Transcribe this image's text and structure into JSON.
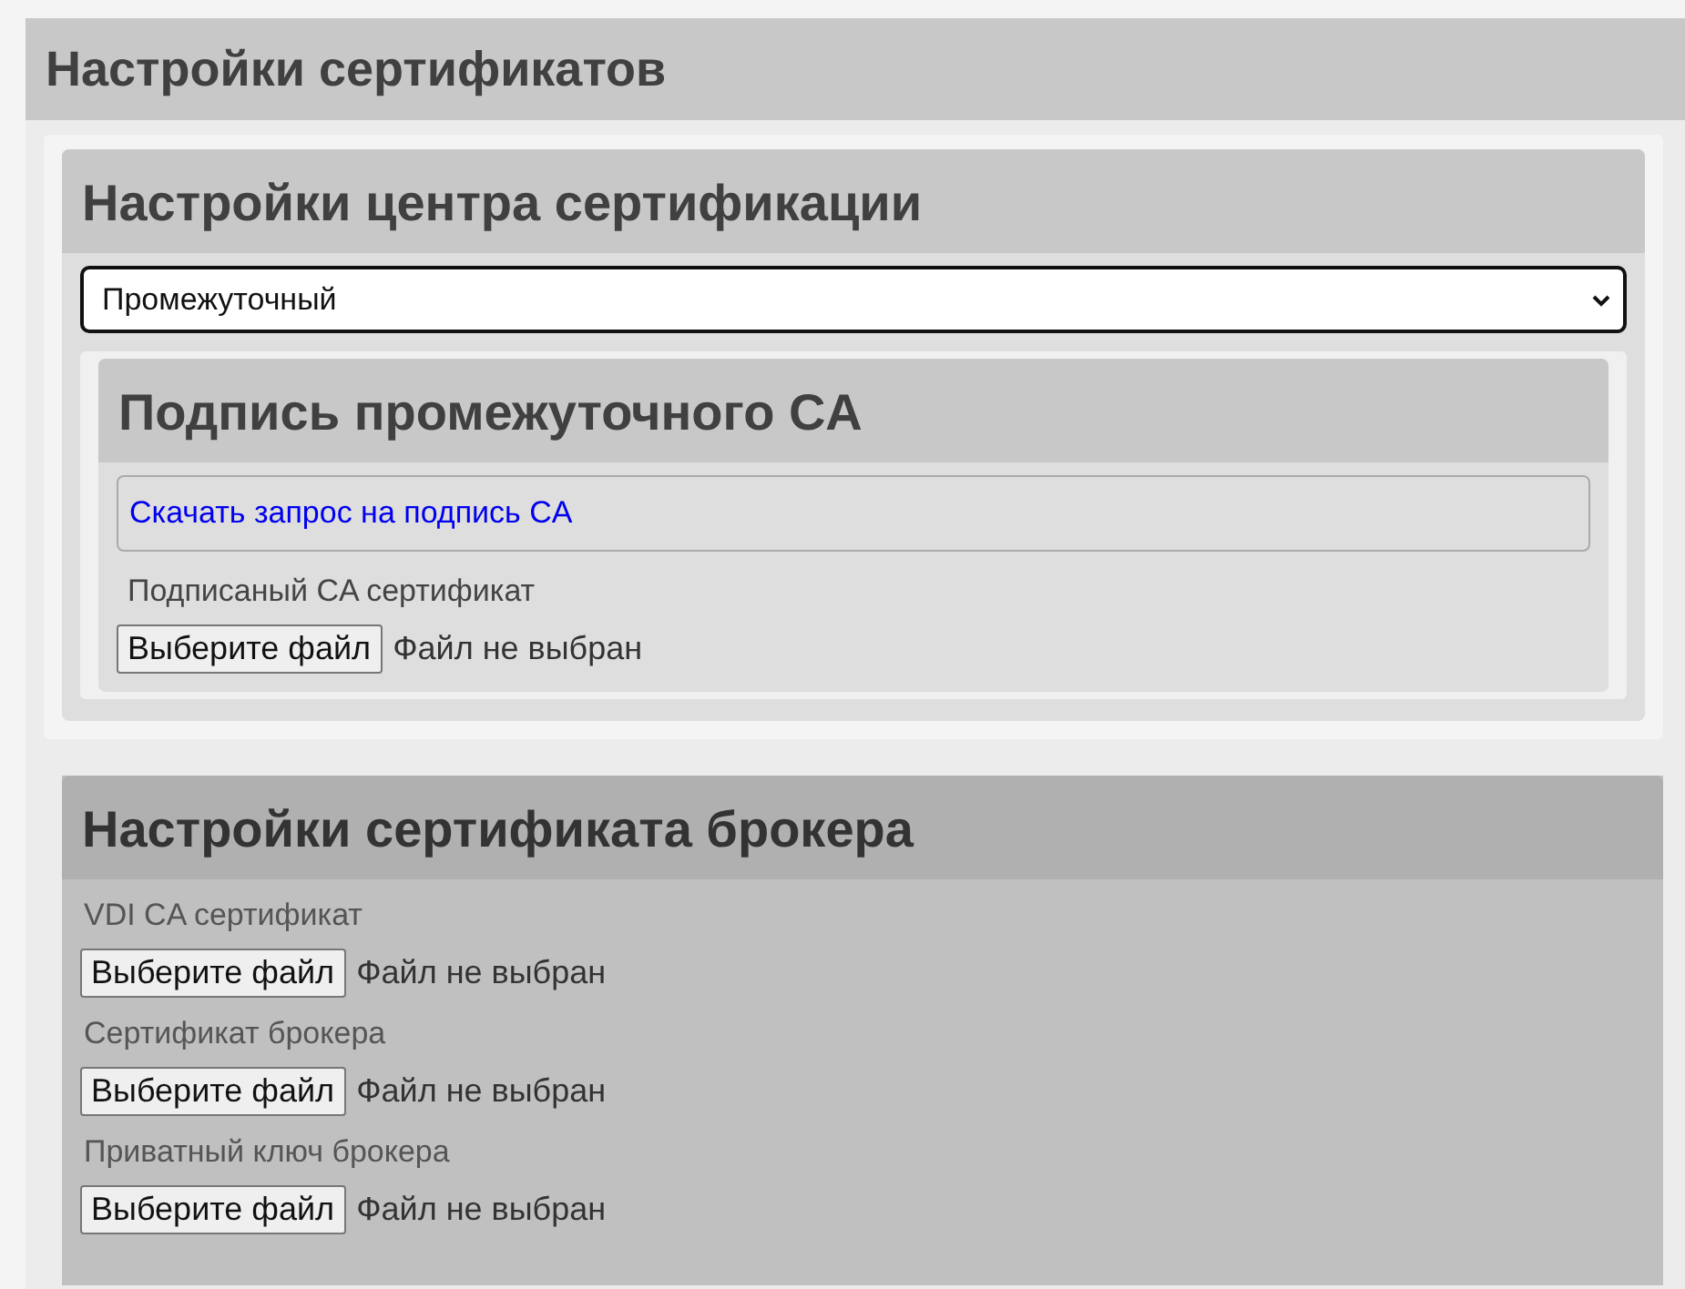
{
  "page_title": "Настройки сертификатов",
  "ca_settings": {
    "title": "Настройки центра сертификации",
    "mode_select": {
      "value": "Промежуточный"
    },
    "intermediate": {
      "title": "Подпись промежуточного CA",
      "download_link": "Скачать запрос на подпись CA",
      "file_label": "Подписаный CA сертификат",
      "file_button": "Выберите файл",
      "file_status": "Файл не выбран"
    }
  },
  "broker_settings": {
    "title": "Настройки сертификата брокера",
    "disabled": true,
    "files": [
      {
        "label": "VDI CA сертификат",
        "button": "Выберите файл",
        "status": "Файл не выбран"
      },
      {
        "label": "Сертификат брокера",
        "button": "Выберите файл",
        "status": "Файл не выбран"
      },
      {
        "label": "Приватный ключ брокера",
        "button": "Выберите файл",
        "status": "Файл не выбран"
      }
    ]
  }
}
